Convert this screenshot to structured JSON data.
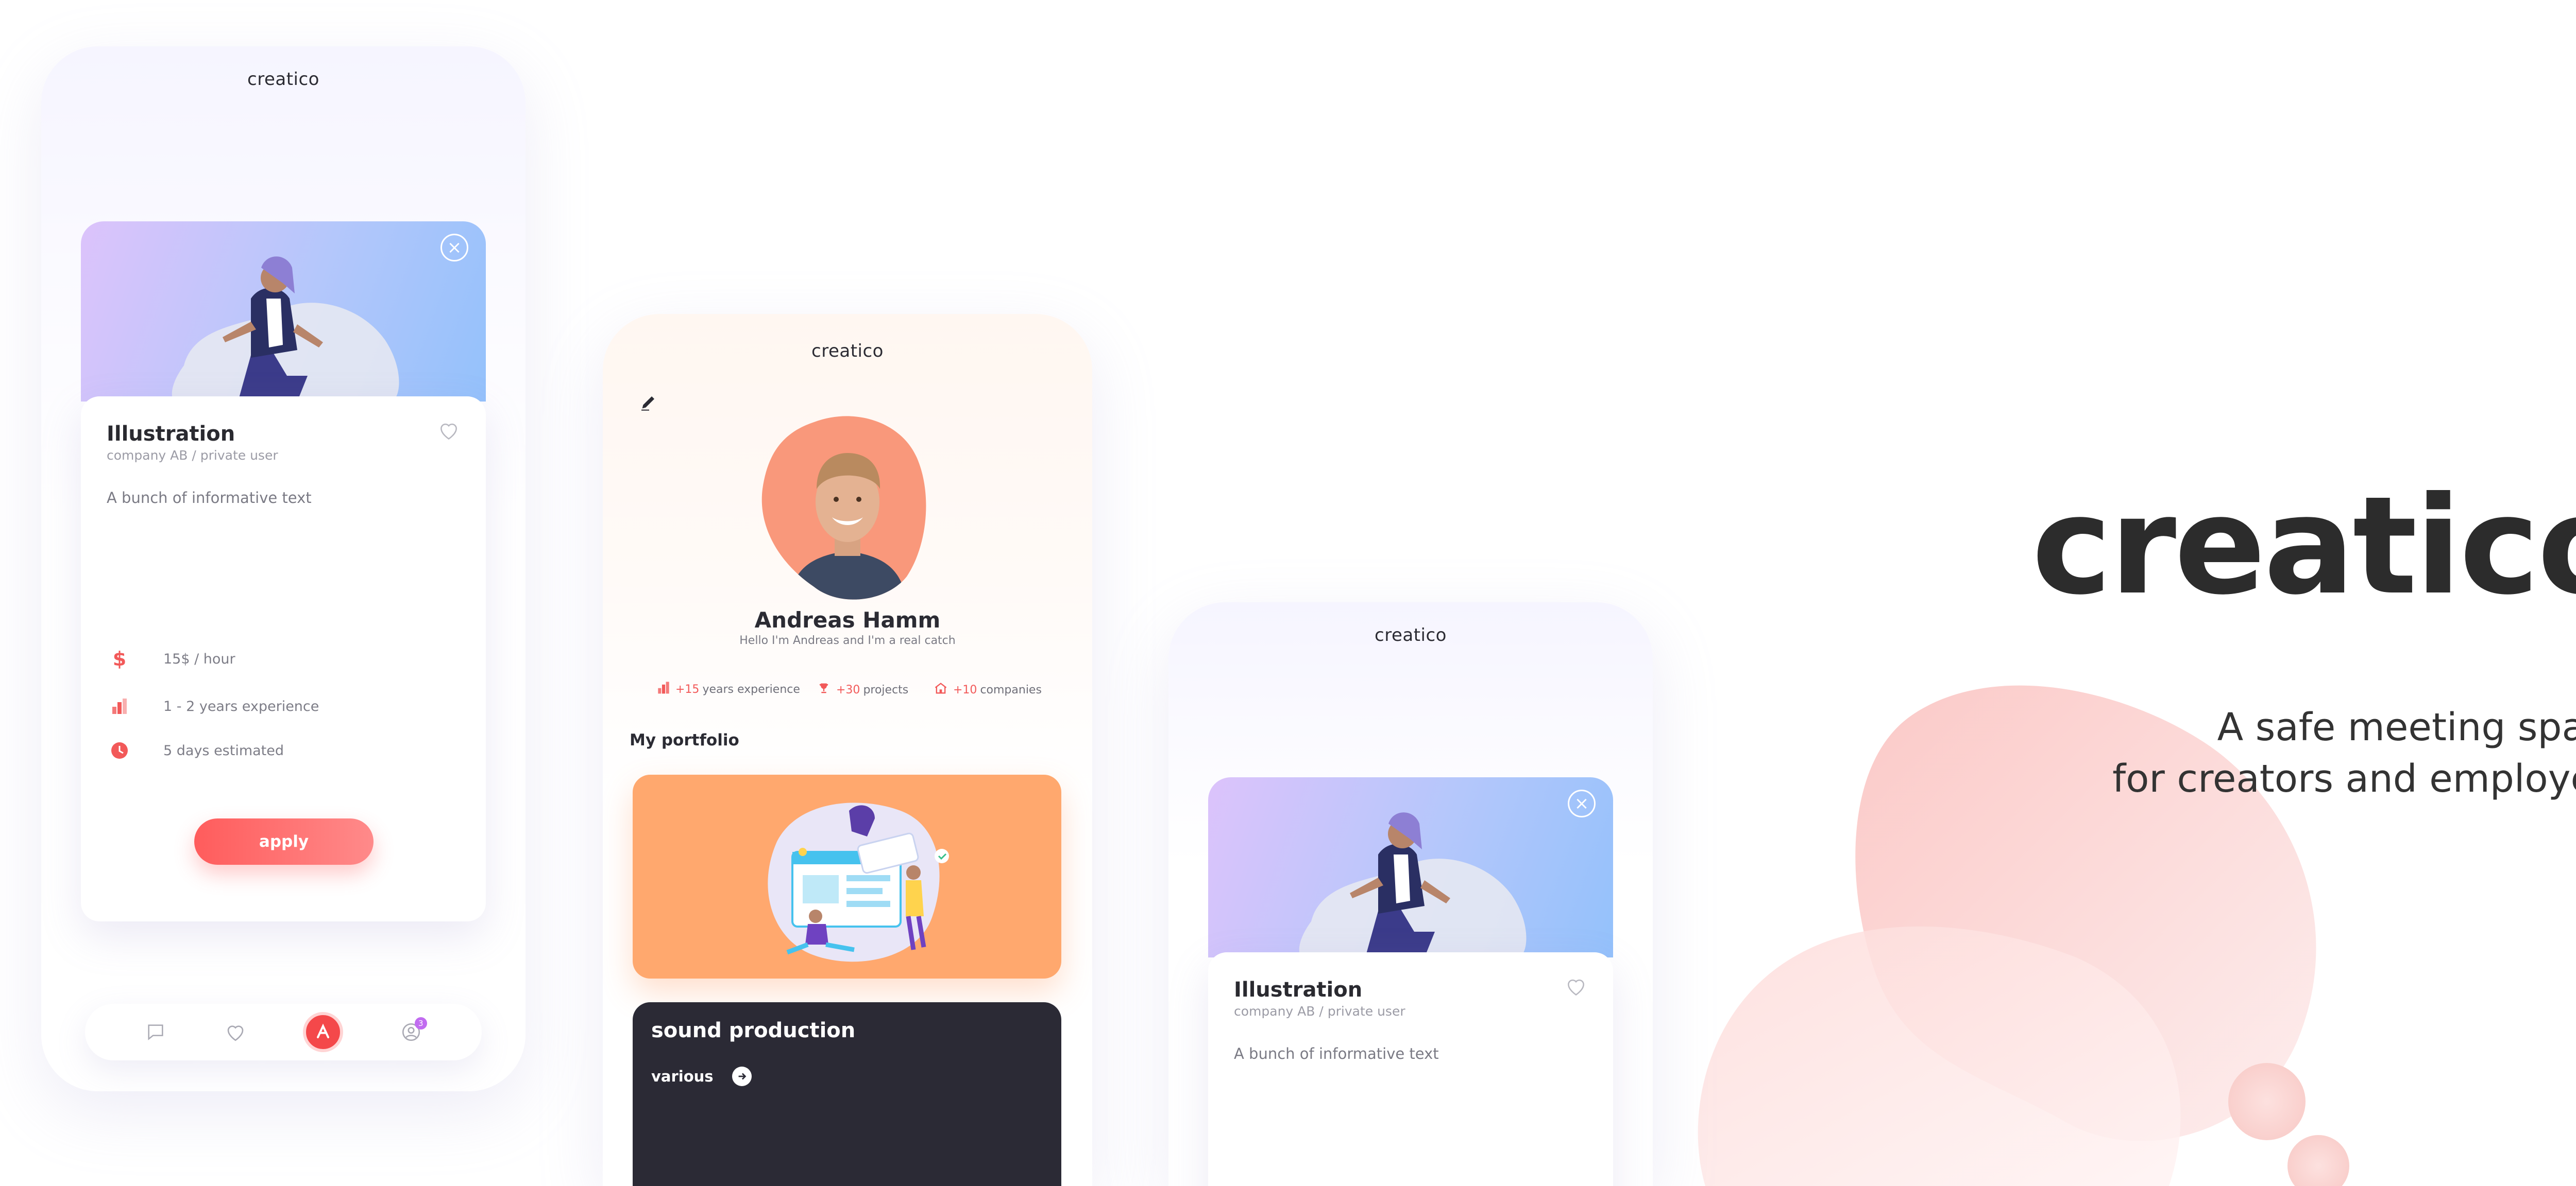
{
  "brand": {
    "name": "creatico",
    "tagline_line1": "A safe meeting space",
    "tagline_line2": "for creators and employers"
  },
  "screen_job_1": {
    "app_title": "creatico",
    "card": {
      "title": "Illustration",
      "subtitle": "company AB / private user",
      "description": "A bunch of informative text",
      "details": [
        {
          "icon": "dollar-icon",
          "text": "15$ / hour"
        },
        {
          "icon": "bar-chart-icon",
          "text": "1 - 2 years experience"
        },
        {
          "icon": "clock-icon",
          "text": "5 days estimated"
        }
      ],
      "apply_label": "apply"
    },
    "nav": {
      "notification_count": "3"
    }
  },
  "screen_profile": {
    "app_title": "creatico",
    "name": "Andreas Hamm",
    "bio": "Hello I'm Andreas and I'm a real catch",
    "stats": [
      {
        "value": "+15",
        "label": "years experience",
        "icon": "bar-chart-icon"
      },
      {
        "value": "+30",
        "label": "projects",
        "icon": "trophy-icon"
      },
      {
        "value": "+10",
        "label": "companies",
        "icon": "building-icon"
      }
    ],
    "portfolio_heading": "My portfolio",
    "portfolio_items": [
      {
        "title": "sound production",
        "tag": "various"
      }
    ]
  },
  "screen_job_2": {
    "app_title": "creatico",
    "card": {
      "title": "Illustration",
      "subtitle": "company AB / private user",
      "description": "A bunch of informative text"
    }
  },
  "colors": {
    "accent": "#f4484a",
    "text_dark": "#2c2c2c",
    "portfolio_orange": "#ffa86e",
    "portfolio_dark": "#2b2a35"
  }
}
